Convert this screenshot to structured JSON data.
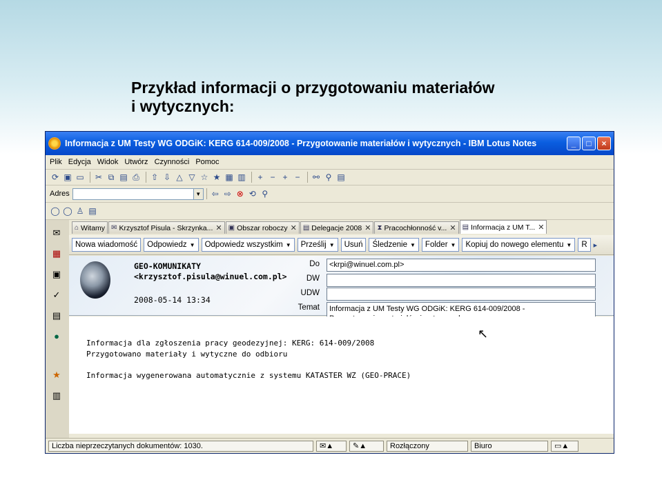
{
  "slide": {
    "title_line1": "Przykład informacji o przygotowaniu materiałów",
    "title_line2": "i wytycznych:"
  },
  "window": {
    "title": "Informacja z UM Testy WG ODGiK: KERG 614-009/2008 - Przygotowanie materiałów i wytycznych - IBM Lotus Notes"
  },
  "menu": [
    "Plik",
    "Edycja",
    "Widok",
    "Utwórz",
    "Czynności",
    "Pomoc"
  ],
  "address": {
    "label": "Adres",
    "value": ""
  },
  "tabs": [
    {
      "label": "Witamy",
      "icon": "home-icon"
    },
    {
      "label": "Krzysztof Pisula - Skrzynka...",
      "icon": "mail-icon"
    },
    {
      "label": "Obszar roboczy",
      "icon": "workspace-icon"
    },
    {
      "label": "Delegacje 2008",
      "icon": "database-icon"
    },
    {
      "label": "Pracochłonność v...",
      "icon": "hourglass-icon"
    },
    {
      "label": "Informacja z UM T...",
      "icon": "document-icon"
    }
  ],
  "actions": [
    {
      "label": "Nowa wiadomość",
      "dropdown": false
    },
    {
      "label": "Odpowiedz",
      "dropdown": true
    },
    {
      "label": "Odpowiedz wszystkim",
      "dropdown": true
    },
    {
      "label": "Prześlij",
      "dropdown": true
    },
    {
      "label": "Usuń",
      "dropdown": false
    },
    {
      "label": "Śledzenie",
      "dropdown": true
    },
    {
      "label": "Folder",
      "dropdown": true
    },
    {
      "label": "Kopiuj do nowego elementu",
      "dropdown": true
    },
    {
      "label": "R",
      "dropdown": false
    }
  ],
  "message": {
    "sender_name": "GEO-KOMUNIKATY",
    "sender_email": "<krzysztof.pisula@winuel.com.pl>",
    "date": "2008-05-14 13:34",
    "labels": {
      "to": "Do",
      "cc": "DW",
      "bcc": "UDW",
      "subject": "Temat"
    },
    "to": "<krpi@winuel.com.pl>",
    "cc": "",
    "bcc": "",
    "subject_line1": "Informacja z UM Testy WG ODGiK: KERG 614-009/2008 -",
    "subject_line2": "Przygotowanie materiałów i wytycznych",
    "body_line1": "Informacja dla zgłoszenia pracy geodezyjnej: KERG: 614-009/2008",
    "body_line2": "Przygotowano materiały i wytyczne do odbioru",
    "body_line3": "Informacja wygenerowana automatycznie z systemu KATASTER WZ (GEO-PRACE)"
  },
  "status": {
    "unread": "Liczba nieprzeczytanych dokumentów: 1030.",
    "connection": "Rozłączony",
    "location": "Biuro"
  }
}
